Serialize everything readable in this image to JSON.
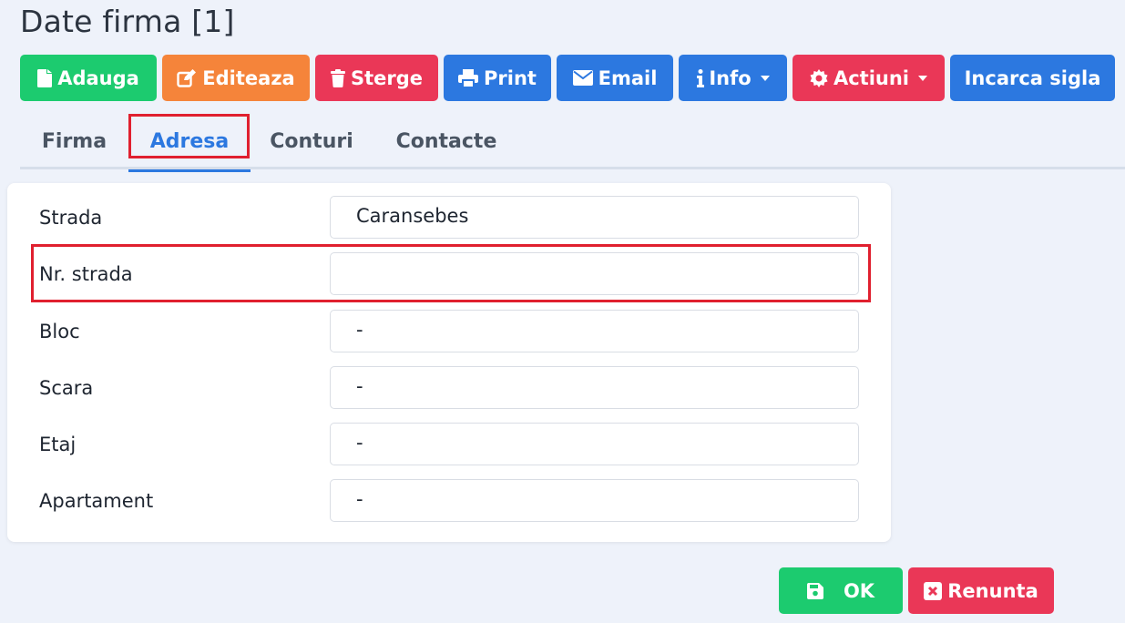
{
  "page": {
    "title": "Date firma [1]"
  },
  "toolbar": {
    "add": "Adauga",
    "edit": "Editeaza",
    "delete": "Sterge",
    "print": "Print",
    "email": "Email",
    "info": "Info",
    "actions": "Actiuni",
    "upload_logo": "Incarca sigla"
  },
  "tabs": [
    "Firma",
    "Adresa",
    "Conturi",
    "Contacte"
  ],
  "active_tab": "Adresa",
  "form": {
    "fields": [
      {
        "label": "Strada",
        "value": "Caransebes"
      },
      {
        "label": "Nr. strada",
        "value": ""
      },
      {
        "label": "Bloc",
        "value": "-"
      },
      {
        "label": "Scara",
        "value": "-"
      },
      {
        "label": "Etaj",
        "value": "-"
      },
      {
        "label": "Apartament",
        "value": "-"
      }
    ]
  },
  "footer": {
    "ok": "OK",
    "cancel": "Renunta"
  },
  "colors": {
    "green": "#1ccb6f",
    "orange": "#f5843a",
    "red": "#ea3757",
    "blue": "#2c78e0",
    "highlight": "#e0202f"
  },
  "icons": {
    "add": "file-icon",
    "edit": "edit-icon",
    "delete": "trash-icon",
    "print": "print-icon",
    "email": "envelope-icon",
    "info": "info-icon",
    "actions": "gear-icon",
    "ok": "save-icon",
    "cancel": "close-box-icon"
  }
}
